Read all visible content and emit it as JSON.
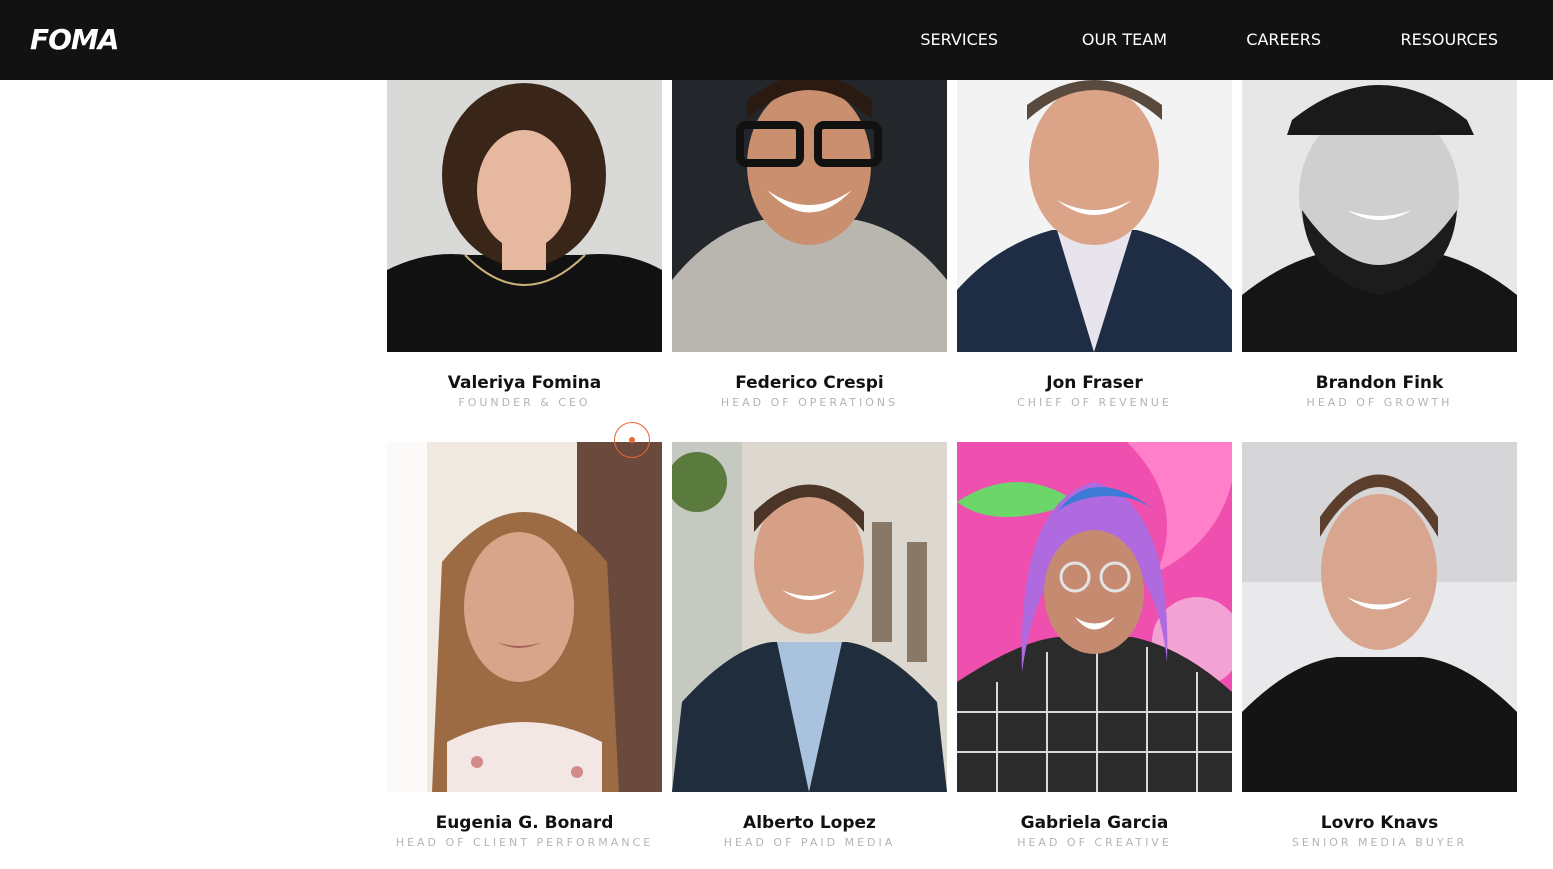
{
  "header": {
    "logo": "FOMA",
    "nav": [
      {
        "label": "SERVICES"
      },
      {
        "label": "OUR TEAM"
      },
      {
        "label": "CAREERS"
      },
      {
        "label": "RESOURCES"
      }
    ]
  },
  "team": {
    "members": [
      {
        "name": "Valeriya Fomina",
        "role": "FOUNDER & CEO"
      },
      {
        "name": "Federico Crespi",
        "role": "HEAD OF OPERATIONS"
      },
      {
        "name": "Jon Fraser",
        "role": "CHIEF OF REVENUE"
      },
      {
        "name": "Brandon Fink",
        "role": "HEAD OF GROWTH"
      },
      {
        "name": "Eugenia G. Bonard",
        "role": "HEAD OF CLIENT PERFORMANCE"
      },
      {
        "name": "Alberto Lopez",
        "role": "HEAD OF PAID MEDIA"
      },
      {
        "name": "Gabriela Garcia",
        "role": "HEAD OF CREATIVE"
      },
      {
        "name": "Lovro Knavs",
        "role": "SENIOR MEDIA BUYER"
      }
    ]
  },
  "colors": {
    "header_bg": "#121212",
    "accent": "#e8652d",
    "role_text": "#b4b4b4"
  }
}
